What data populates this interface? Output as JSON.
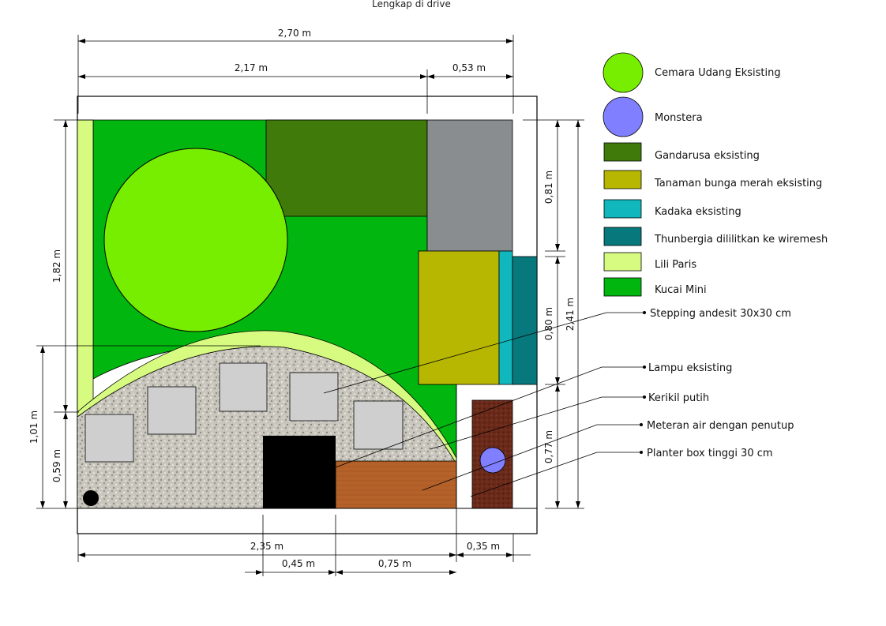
{
  "caption": "Lengkap di drive",
  "colors": {
    "cemara": "#77ee00",
    "monstera": "#7f7fff",
    "gandarusa": "#3f7a0a",
    "bunga_merah": "#b7b600",
    "kadaka": "#10b8bd",
    "thunbergia": "#07787c",
    "lili_paris": "#d6fb80",
    "kucai_mini": "#00b60f",
    "gravel": "#c9c6bd",
    "stone": "#cfcfcf",
    "planter": "#b5622a",
    "water_meter": "#000000",
    "wall_pavement": "#8a8d90",
    "planter_tall": "#6a2a1a"
  },
  "legend": [
    {
      "label": "Cemara Udang Eksisting",
      "shape": "circle",
      "color": "#77ee00"
    },
    {
      "label": "Monstera",
      "shape": "circle",
      "color": "#7f7fff"
    },
    {
      "label": "Gandarusa eksisting",
      "shape": "rect",
      "color": "#3f7a0a"
    },
    {
      "label": "Tanaman bunga merah eksisting",
      "shape": "rect",
      "color": "#b7b600"
    },
    {
      "label": "Kadaka eksisting",
      "shape": "rect",
      "color": "#10b8bd"
    },
    {
      "label": "Thunbergia dililitkan ke wiremesh",
      "shape": "rect",
      "color": "#07787c"
    },
    {
      "label": "Lili Paris",
      "shape": "rect",
      "color": "#d6fb80"
    },
    {
      "label": "Kucai Mini",
      "shape": "rect",
      "color": "#00b60f"
    }
  ],
  "callouts": [
    "Stepping andesit 30x30 cm",
    "Lampu eksisting",
    "Kerikil putih",
    "Meteran air dengan penutup",
    "Planter box tinggi 30 cm"
  ],
  "dimensions": {
    "top_total": "2,70 m",
    "top_left": "2,17 m",
    "top_right": "0,53 m",
    "left_upper": "1,82 m",
    "left_lower_outer": "1,01 m",
    "left_lower_inner": "0,59 m",
    "right_top": "0,81 m",
    "right_mid": "0,80 m",
    "right_bottom": "0,77 m",
    "right_total": "2,41 m",
    "bottom_left": "2,35 m",
    "bottom_right": "0,35 m",
    "bottom_meter": "0,45 m",
    "bottom_planter": "0,75 m"
  }
}
